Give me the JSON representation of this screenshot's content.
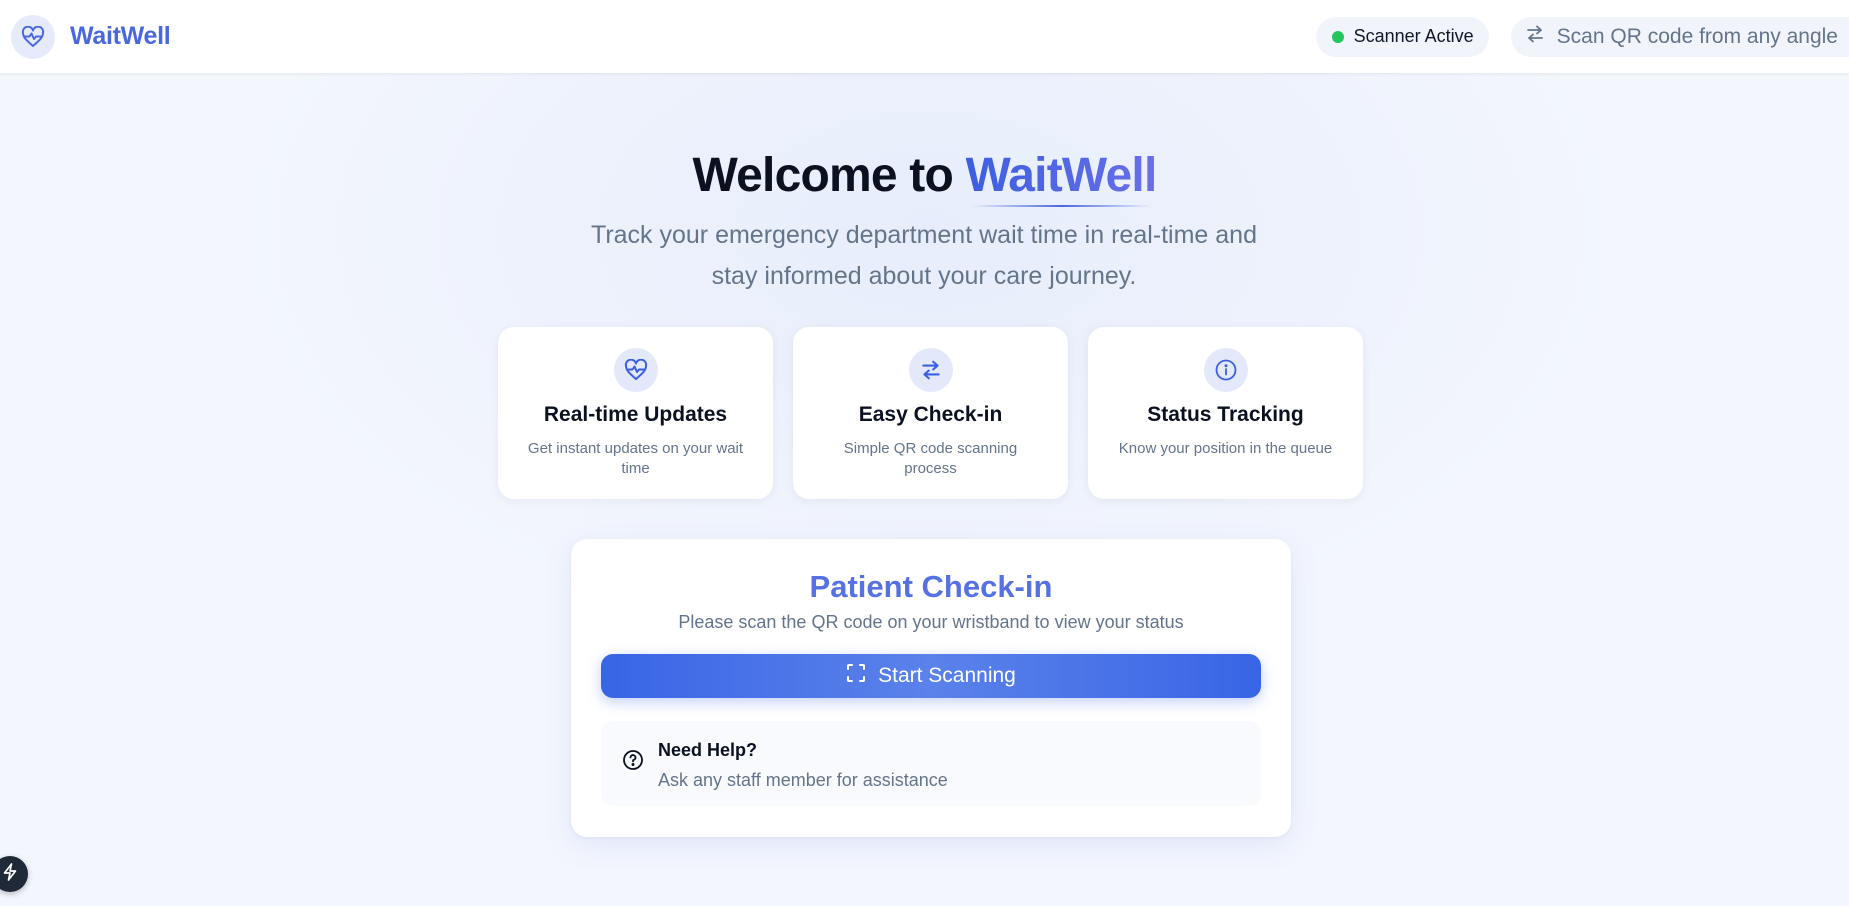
{
  "header": {
    "brand_name": "WaitWell",
    "brand_icon": "heart-pulse-icon",
    "status_label": "Scanner Active",
    "status_color": "#22c55e",
    "hint_label": "Scan QR code from any angle",
    "hint_icon": "arrows-exchange-icon"
  },
  "hero": {
    "title_prefix": "Welcome to ",
    "title_accent": "WaitWell",
    "subtitle": "Track your emergency department wait time in real-time and stay informed about your care journey."
  },
  "features": [
    {
      "icon": "heart-pulse-icon",
      "title": "Real-time Updates",
      "description": "Get instant updates on your wait time"
    },
    {
      "icon": "arrows-exchange-icon",
      "title": "Easy Check-in",
      "description": "Simple QR code scanning process"
    },
    {
      "icon": "info-icon",
      "title": "Status Tracking",
      "description": "Know your position in the queue"
    }
  ],
  "checkin": {
    "title": "Patient Check-in",
    "subtitle": "Please scan the QR code on your wristband to view your status",
    "button_label": "Start Scanning",
    "button_icon": "scan-frame-icon",
    "help_title": "Need Help?",
    "help_text": "Ask any staff member for assistance",
    "help_icon": "question-circle-icon"
  },
  "colors": {
    "brand": "#4a68de",
    "button": "#3865e6",
    "background": "#f3f6fd"
  },
  "corner_button_icon": "lightning-icon"
}
